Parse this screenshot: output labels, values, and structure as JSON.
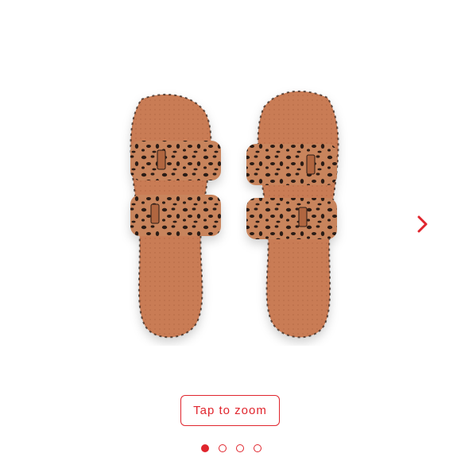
{
  "gallery": {
    "image": {
      "alt_icon": "leopard-print-slide-sandals-image"
    },
    "next_icon": "chevron-right-icon",
    "zoom_button_label": "Tap to zoom",
    "pagination": {
      "total": 4,
      "active_index": 0
    },
    "accent_color": "#e0252d",
    "sandal_base_color": "#c97b55"
  }
}
